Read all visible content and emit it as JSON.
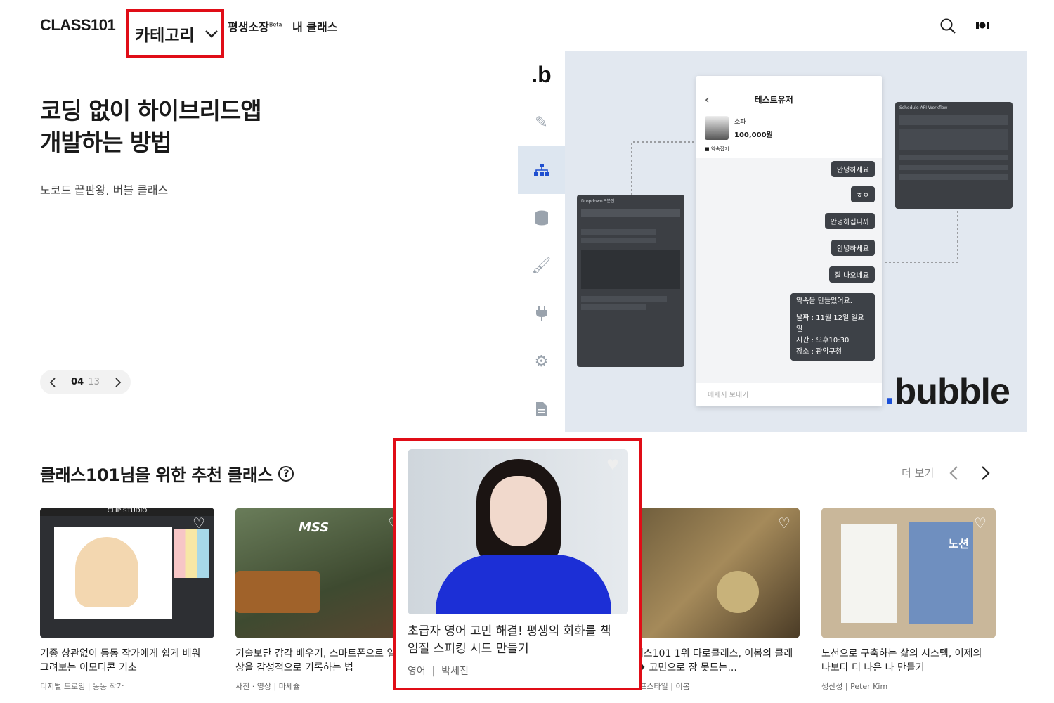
{
  "header": {
    "logo": "CLASS101",
    "category_label": "카테고리",
    "nav_lifetime": "평생소장",
    "nav_beta": "Beta",
    "nav_my_class": "내 클래스",
    "search_icon": "search-icon",
    "profile_icon": "profile-icon"
  },
  "hero": {
    "title_line1": "코딩 없이 하이브리드앱",
    "title_line2": "개발하는 방법",
    "subtitle": "노코드 끝판왕, 버블 클래스",
    "page_current": "04",
    "page_total": "13",
    "banner": {
      "brand": "bubble",
      "logo_letter": ".b",
      "chat_title": "테스트유저",
      "product_name": "소파",
      "product_price": "100,000원",
      "product_tag": "■ 약속잡기",
      "input_placeholder": "메세지 보내기",
      "left_panel_title": "Dropdown 5분전",
      "right_panel_title": "Schedule API Workflow",
      "messages": [
        "안녕하세요",
        "ㅎㅇ",
        "안녕하십니까",
        "안녕하세요",
        "잘 나오네요"
      ],
      "appointment": {
        "heading": "약속을 만들었어요.",
        "date": "날짜 : 11월 12일 일요일",
        "time": "시간 : 오후10:30",
        "place": "장소 : 관악구청"
      }
    }
  },
  "recommend": {
    "title": "클래스101님을 위한 추천 클래스",
    "more_label": "더 보기",
    "cards": [
      {
        "title": "기종 상관없이 동동 작가에게 쉽게 배워 그려보는 이모티콘 기초",
        "category": "디지털 드로잉",
        "creator": "동동 작가",
        "thumb_text": "CLIP STUDIO"
      },
      {
        "title": "기술보단 감각 배우기, 스마트폰으로 일상을 감성적으로 기록하는 법",
        "category": "사진 · 영상",
        "creator": "마세슐",
        "thumb_text": "MSS"
      },
      {
        "title": "초급자 영어 고민 해결! 평생의 회화를 책임질 스피킹 시드 만들기",
        "category": "영어",
        "creator": "박세진"
      },
      {
        "title": "클래스101 1위 타로클래스, 이봄의 클래스 ❥ 고민으로 잠 못드는...",
        "category": "라이프스타일",
        "creator": "이봄"
      },
      {
        "title": "노션으로 구축하는 삶의 시스템, 어제의 나보다 더 나은 나 만들기",
        "category": "생산성",
        "creator": "Peter Kim",
        "thumb_text": "노션"
      }
    ]
  },
  "colors": {
    "highlight": "#e00d17",
    "accent_blue": "#1a4fd8"
  }
}
